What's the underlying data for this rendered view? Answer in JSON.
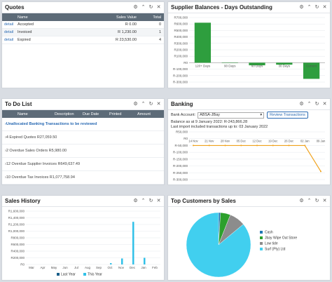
{
  "panels": {
    "quotes": {
      "title": "Quotes",
      "columns": [
        "Name",
        "Sales Value",
        "Total"
      ],
      "rows": [
        {
          "action": "detail",
          "name": "Accepted",
          "value": "R 0.00",
          "total": "0"
        },
        {
          "action": "detail",
          "name": "Invoiced",
          "value": "R 1,230.00",
          "total": "1"
        },
        {
          "action": "detail",
          "name": "Expired",
          "value": "R 23,530.00",
          "total": "4"
        }
      ]
    },
    "supplier": {
      "title": "Supplier Balances - Days Outstanding"
    },
    "todo": {
      "title": "To Do List",
      "columns": [
        "Name",
        "Description",
        "Due Date",
        "Printed",
        "Amount"
      ],
      "items": [
        "Unallocated Banking Transactions to be reviewed",
        "4 Expired Quotes R27,059.50",
        "2 Overdue Sales Orders R5,980.00",
        "12 Overdue Supplier Invoices R649,637.49",
        "10 Overdue Tax Invoices R1,077,758.94"
      ]
    },
    "banking": {
      "title": "Banking",
      "account_label": "Bank Account:",
      "account_value": "ABSA-JBay",
      "review_button": "Review Transactions",
      "balance_line": "Balance as at 9 January 2022: R-243,866.28",
      "import_line": "Last import included transactions up to: 03 January 2022"
    },
    "sales": {
      "title": "Sales History"
    },
    "customers": {
      "title": "Top Customers by Sales"
    }
  },
  "icons": [
    "gear-icon",
    "minimize-icon",
    "refresh-icon",
    "close-icon"
  ],
  "colors": {
    "supplier_green": "#2e9e3e",
    "banking_line": "#f0a21d",
    "last_year": "#1a5f8a",
    "this_year": "#31c1e8",
    "pie_cash": "#1f77b4",
    "pie_jbay": "#2ca02c",
    "pie_lowtide": "#8c8c8c",
    "pie_surf": "#41cfef"
  },
  "chart_data": [
    {
      "type": "bar",
      "title": "",
      "categories": [
        "120+ Days",
        "90 Days",
        "60 Days",
        "30 Days",
        "Current"
      ],
      "values": [
        620000,
        0,
        -40000,
        -30000,
        -250000
      ],
      "ylim": [
        -300000,
        700000
      ],
      "yticks": [
        "R700,000",
        "R600,000",
        "R500,000",
        "R400,000",
        "R300,000",
        "R200,000",
        "R100,000",
        "R0",
        "R-100,000",
        "R-200,000",
        "R-300,000"
      ],
      "grid": true
    },
    {
      "type": "line",
      "categories": [
        "14 Nov",
        "21 Nov",
        "28 Nov",
        "05 Dec",
        "12 Dec",
        "19 Dec",
        "26 Dec",
        "02 Jan",
        "09 Jan"
      ],
      "values": [
        -50000,
        -50000,
        -50000,
        -50000,
        -50000,
        -50000,
        -50000,
        -50000,
        -240000
      ],
      "ylim": [
        -300000,
        50000
      ],
      "yticks": [
        "R50,000",
        "R0",
        "R-50,000",
        "R-100,000",
        "R-150,000",
        "R-200,000",
        "R-250,000",
        "R-300,000"
      ],
      "grid": true
    },
    {
      "type": "bar",
      "categories": [
        "Mar",
        "Apr",
        "May",
        "Jun",
        "Jul",
        "Aug",
        "Sep",
        "Oct",
        "Nov",
        "Dec",
        "Jan",
        "Feb"
      ],
      "series": [
        {
          "name": "Last Year",
          "values": [
            0,
            0,
            0,
            0,
            0,
            0,
            0,
            0,
            0,
            0,
            0,
            0
          ]
        },
        {
          "name": "This Year",
          "values": [
            0,
            0,
            0,
            0,
            0,
            0,
            0,
            40000,
            180000,
            1280000,
            200000,
            0
          ]
        }
      ],
      "ylim": [
        0,
        1600000
      ],
      "yticks": [
        "R1,600,000",
        "R1,400,000",
        "R1,200,000",
        "R1,000,000",
        "R800,000",
        "R600,000",
        "R400,000",
        "R200,000",
        "R0"
      ],
      "legend": "bottom",
      "grid": true
    },
    {
      "type": "pie",
      "labels": [
        "Cash",
        "Jbay Wipe Out Store",
        "Low tide",
        "Surf (Pty) Ltd"
      ],
      "values": [
        1,
        5,
        8,
        86
      ],
      "legend": "right"
    }
  ]
}
